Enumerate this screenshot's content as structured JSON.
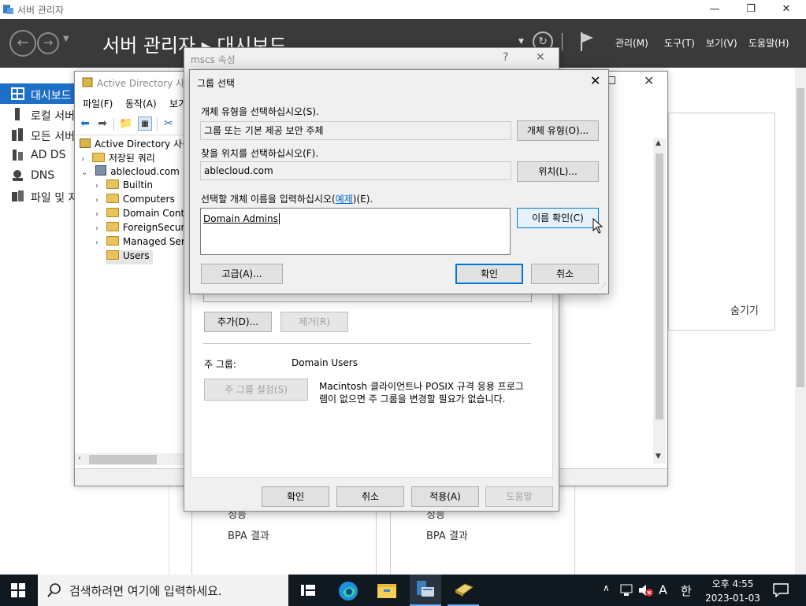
{
  "server_manager": {
    "window_title": "서버 관리자",
    "breadcrumb": "서버 관리자 ▸ 대시보드",
    "header_menu": [
      "관리(M)",
      "도구(T)",
      "보기(V)",
      "도움말(H)"
    ],
    "sidebar": [
      {
        "label": "대시보드",
        "icon": "dashboard-icon",
        "active": true
      },
      {
        "label": "로컬 서버",
        "icon": "server-icon",
        "active": false
      },
      {
        "label": "모든 서버",
        "icon": "servers-icon",
        "active": false
      },
      {
        "label": "AD DS",
        "icon": "ad-ds-icon",
        "active": false
      },
      {
        "label": "DNS",
        "icon": "dns-icon",
        "active": false
      },
      {
        "label": "파일 및 저",
        "icon": "file-storage-icon",
        "active": false
      }
    ],
    "hide_label": "숨기기",
    "tile1": {
      "perf": "성능",
      "bpa": "BPA 결과"
    },
    "tile2": {
      "perf": "성능",
      "bpa": "BPA 결과"
    }
  },
  "aduc": {
    "title": "Active Directory 사용자 및 컴퓨터",
    "menu": [
      "파일(F)",
      "동작(A)",
      "보기"
    ],
    "tree": [
      {
        "label": "Active Directory 사용자 및 컴퓨터",
        "level": 0,
        "chevron": ""
      },
      {
        "label": "저장된 쿼리",
        "level": 1,
        "chevron": "›"
      },
      {
        "label": "ablecloud.com",
        "level": 1,
        "chevron": "⌄"
      },
      {
        "label": "Builtin",
        "level": 2,
        "chevron": "›"
      },
      {
        "label": "Computers",
        "level": 2,
        "chevron": "›"
      },
      {
        "label": "Domain Controllers",
        "level": 2,
        "chevron": "›"
      },
      {
        "label": "ForeignSecurityPrincipals",
        "level": 2,
        "chevron": "›"
      },
      {
        "label": "Managed Service Accounts",
        "level": 2,
        "chevron": "›"
      },
      {
        "label": "Users",
        "level": 2,
        "chevron": ""
      }
    ]
  },
  "props": {
    "title": "mscs 속성",
    "help_glyph": "?",
    "add_button": "추가(D)...",
    "remove_button": "제거(R)",
    "primary_group_label": "주 그룹:",
    "primary_group_value": "Domain Users",
    "set_primary_button": "주 그룹 설정(S)",
    "mac_note": "Macintosh 클라이언트나 POSIX 규격 응용 프로그램이 없으면 주 그룹을 변경할 필요가 없습니다.",
    "mac_note_line1": "Macintosh 클라이언트나 POSIX 규격 응용 프로그",
    "mac_note_line2": "램이 없으면 주 그룹을 변경할 필요가 없습니다.",
    "footer_buttons": {
      "ok": "확인",
      "cancel": "취소",
      "apply": "적용(A)",
      "help": "도움말"
    }
  },
  "select_groups": {
    "title": "그룹 선택",
    "object_type_label": "개체 유형을 선택하십시오(S).",
    "object_type_value": "그룹 또는 기본 제공 보안 주체",
    "object_types_button": "개체 유형(O)...",
    "location_label": "찾을 위치를 선택하십시오(F).",
    "location_value": "ablecloud.com",
    "locations_button": "위치(L)...",
    "names_label_pre": "선택할 개체 이름을 입력하십시오(",
    "names_label_link": "예제",
    "names_label_post": ")(E).",
    "names_value": "Domain Admins",
    "check_names_button": "이름 확인(C)",
    "advanced_button": "고급(A)...",
    "ok_button": "확인",
    "cancel_button": "취소"
  },
  "taskbar": {
    "search_placeholder": "검색하려면 여기에 입력하세요.",
    "tray_ime": "A",
    "tray_lang": "한",
    "time": "오후 4:55",
    "date": "2023-01-03"
  },
  "colors": {
    "accent": "#1e6fc6",
    "header_bg": "#3a3a3a",
    "taskbar_bg": "#101820",
    "focus_blue": "#0078d7"
  }
}
